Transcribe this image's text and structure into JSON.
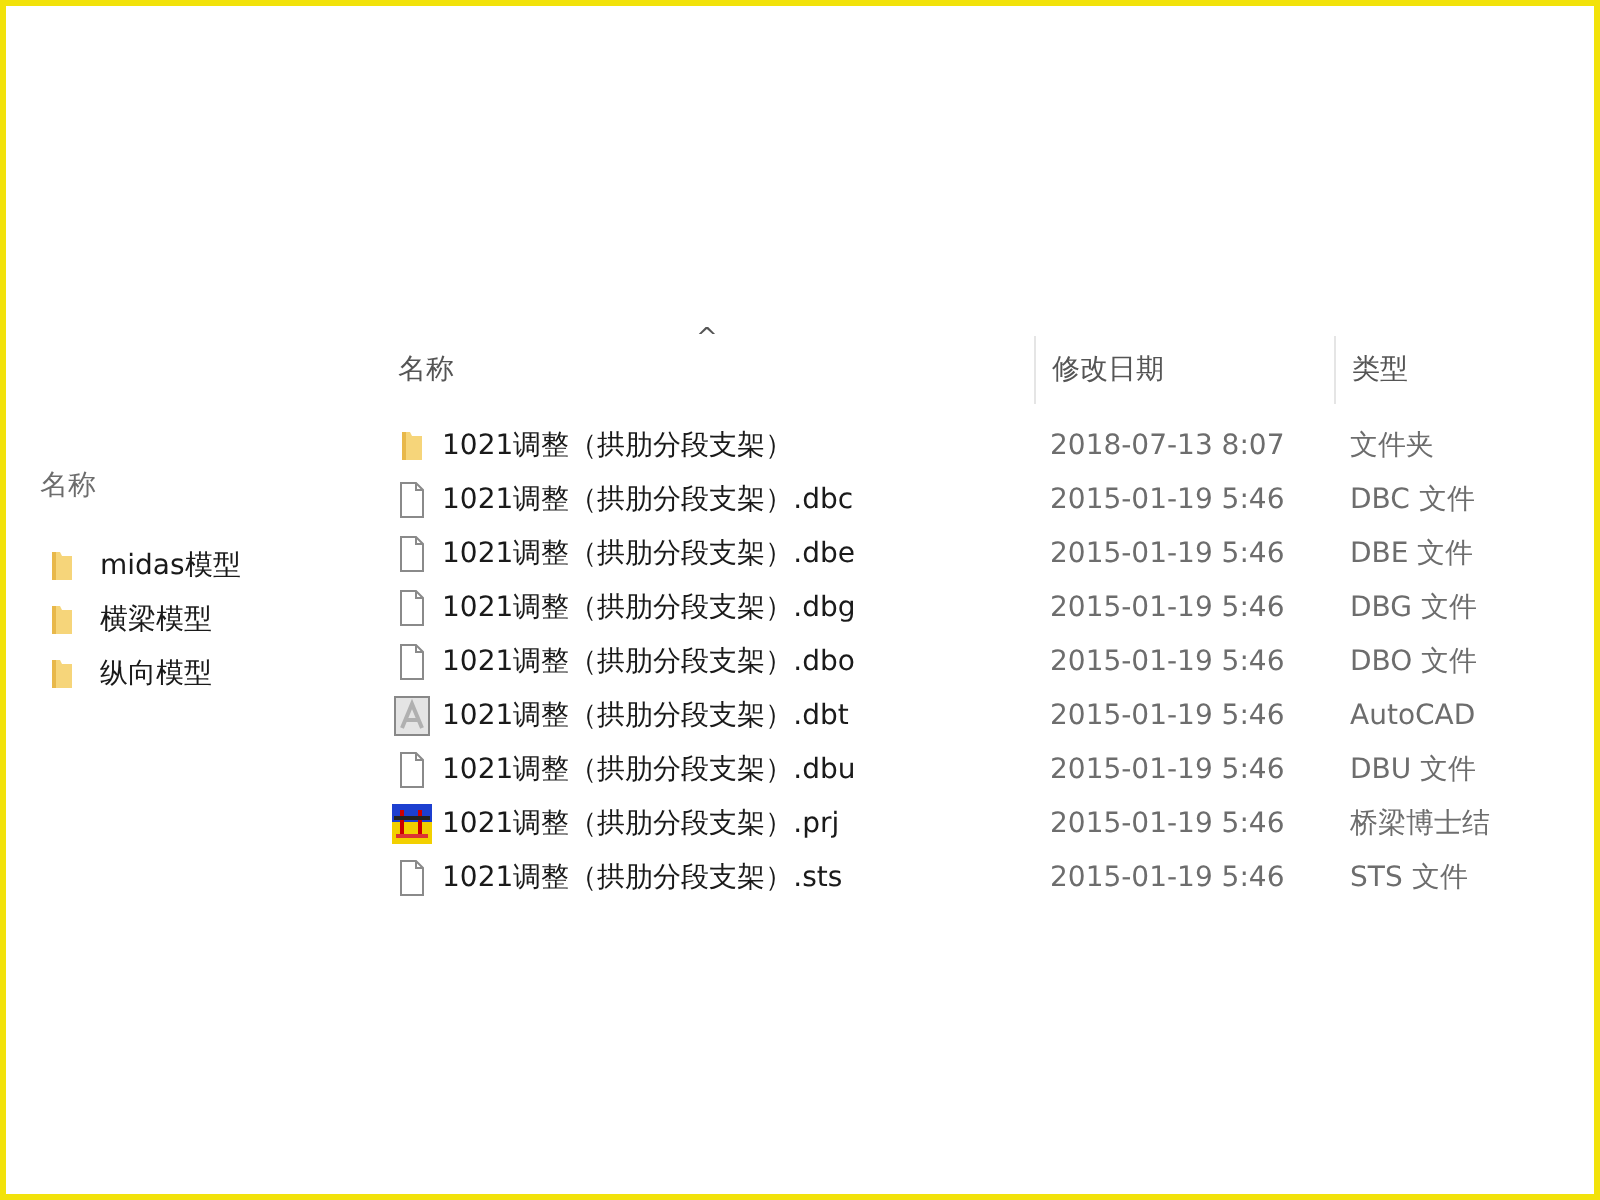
{
  "left_panel": {
    "header": "名称",
    "items": [
      {
        "name": "midas模型",
        "kind": "folder"
      },
      {
        "name": "横梁模型",
        "kind": "folder"
      },
      {
        "name": "纵向模型",
        "kind": "folder"
      }
    ]
  },
  "file_list": {
    "columns": [
      {
        "label": "名称",
        "sort_indicator": "^"
      },
      {
        "label": "修改日期"
      },
      {
        "label": "类型"
      }
    ],
    "rows": [
      {
        "name": "1021调整（拱肋分段支架）",
        "date": "2018-07-13 8:07",
        "type": "文件夹",
        "kind": "folder"
      },
      {
        "name": "1021调整（拱肋分段支架）.dbc",
        "date": "2015-01-19 5:46",
        "type": "DBC 文件",
        "kind": "file"
      },
      {
        "name": "1021调整（拱肋分段支架）.dbe",
        "date": "2015-01-19 5:46",
        "type": "DBE 文件",
        "kind": "file"
      },
      {
        "name": "1021调整（拱肋分段支架）.dbg",
        "date": "2015-01-19 5:46",
        "type": "DBG 文件",
        "kind": "file"
      },
      {
        "name": "1021调整（拱肋分段支架）.dbo",
        "date": "2015-01-19 5:46",
        "type": "DBO 文件",
        "kind": "file"
      },
      {
        "name": "1021调整（拱肋分段支架）.dbt",
        "date": "2015-01-19 5:46",
        "type": "AutoCAD",
        "kind": "cad"
      },
      {
        "name": "1021调整（拱肋分段支架）.dbu",
        "date": "2015-01-19 5:46",
        "type": "DBU 文件",
        "kind": "file"
      },
      {
        "name": "1021调整（拱肋分段支架）.prj",
        "date": "2015-01-19 5:46",
        "type": "桥梁博士结",
        "kind": "app"
      },
      {
        "name": "1021调整（拱肋分段支架）.sts",
        "date": "2015-01-19 5:46",
        "type": "STS 文件",
        "kind": "file"
      }
    ]
  }
}
